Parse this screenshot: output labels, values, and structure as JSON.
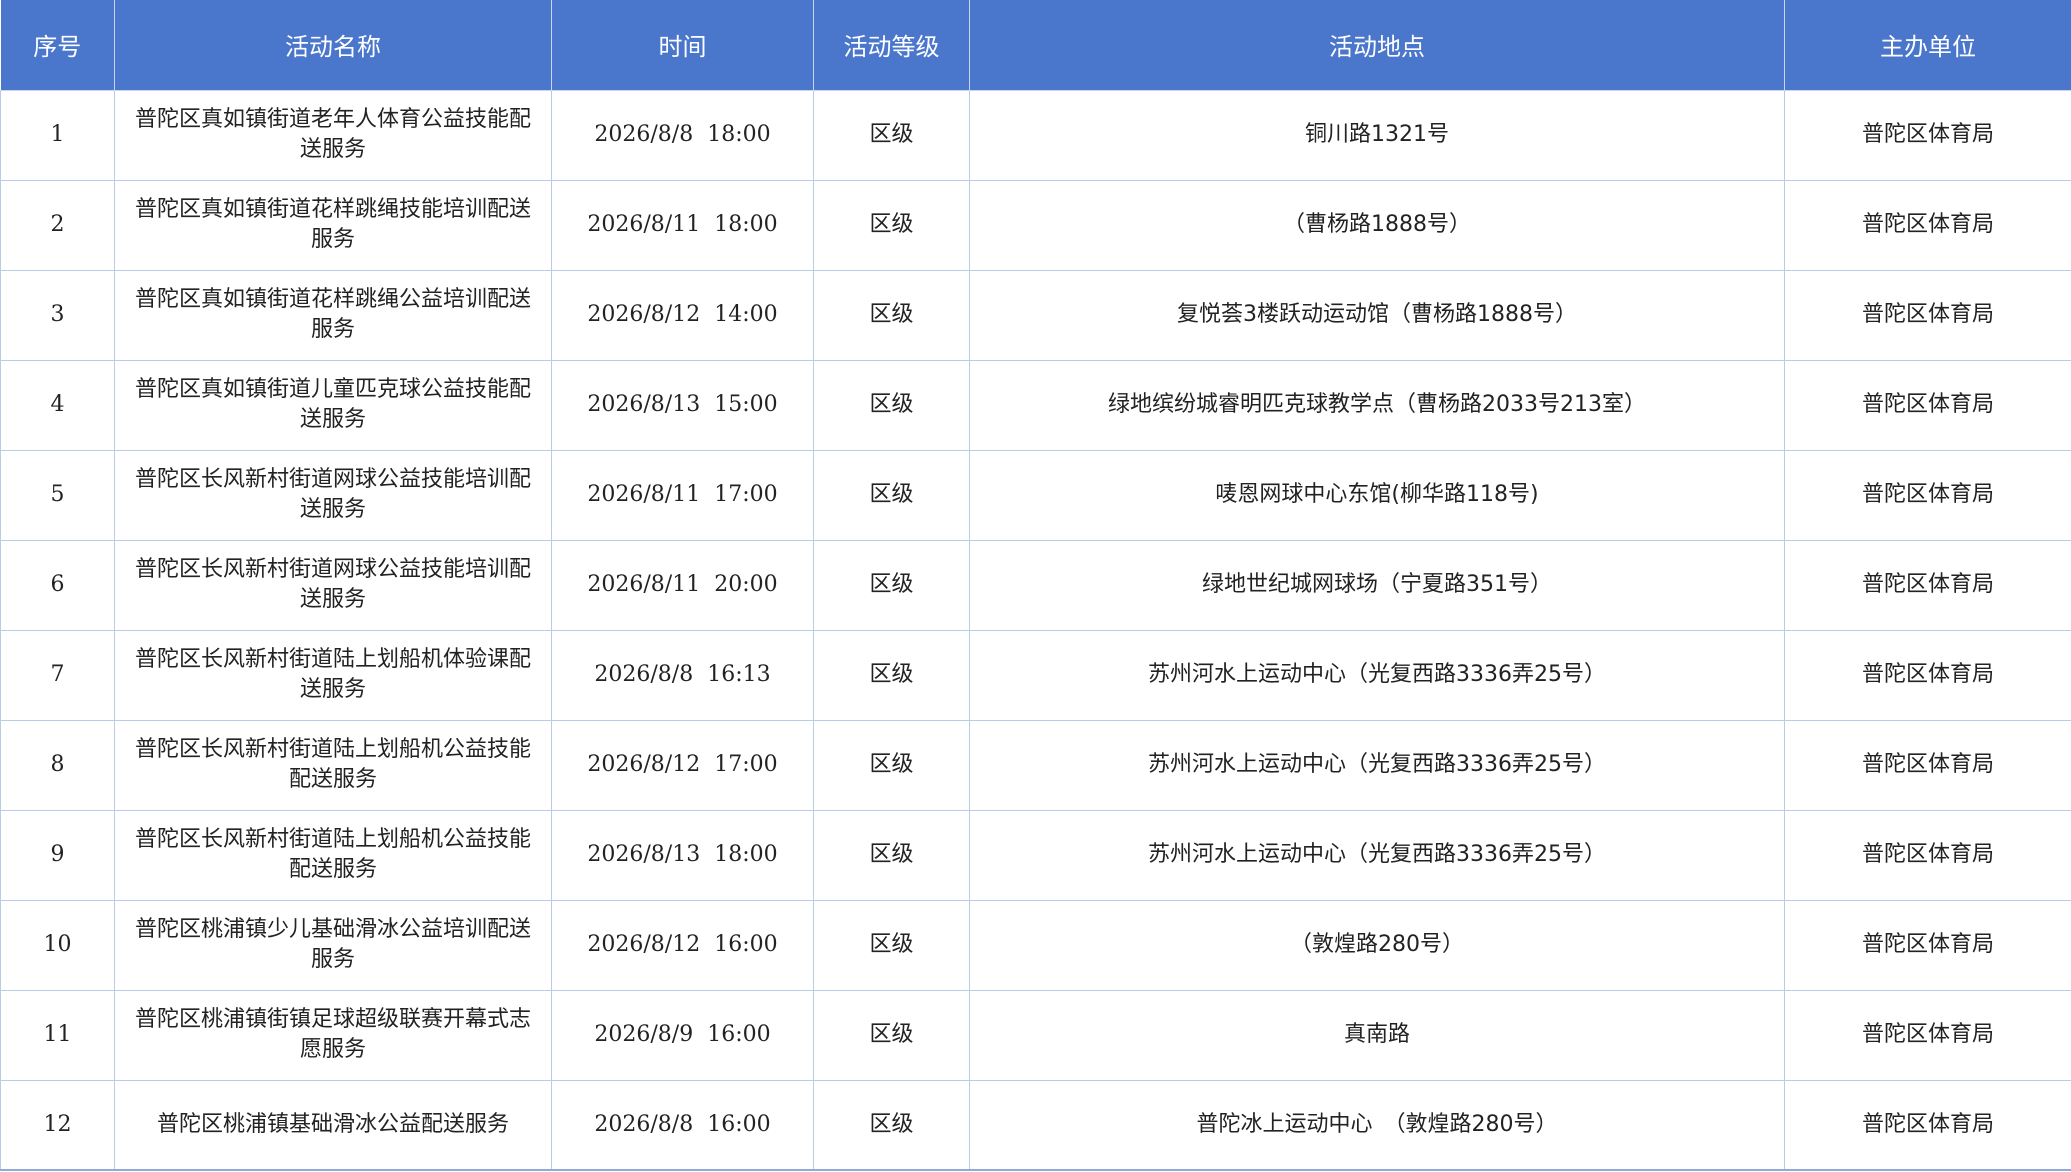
{
  "table": {
    "headers": {
      "index": "序号",
      "name": "活动名称",
      "time": "时间",
      "level": "活动等级",
      "location": "活动地点",
      "organizer": "主办单位"
    },
    "rows": [
      {
        "index": "1",
        "name": "普陀区真如镇街道老年人体育公益技能配送服务",
        "date": "2026/8/8",
        "clock": "18:00",
        "level": "区级",
        "location": "铜川路1321号",
        "organizer": "普陀区体育局"
      },
      {
        "index": "2",
        "name": "普陀区真如镇街道花样跳绳技能培训配送服务",
        "date": "2026/8/11",
        "clock": "18:00",
        "level": "区级",
        "location": "（曹杨路1888号）",
        "organizer": "普陀区体育局"
      },
      {
        "index": "3",
        "name": "普陀区真如镇街道花样跳绳公益培训配送服务",
        "date": "2026/8/12",
        "clock": "14:00",
        "level": "区级",
        "location": "复悦荟3楼跃动运动馆（曹杨路1888号）",
        "organizer": "普陀区体育局"
      },
      {
        "index": "4",
        "name": "普陀区真如镇街道儿童匹克球公益技能配送服务",
        "date": "2026/8/13",
        "clock": "15:00",
        "level": "区级",
        "location": "绿地缤纷城睿明匹克球教学点（曹杨路2033号213室）",
        "organizer": "普陀区体育局"
      },
      {
        "index": "5",
        "name": "普陀区长风新村街道网球公益技能培训配送服务",
        "date": "2026/8/11",
        "clock": "17:00",
        "level": "区级",
        "location": "唛恩网球中心东馆(柳华路118号)",
        "organizer": "普陀区体育局"
      },
      {
        "index": "6",
        "name": "普陀区长风新村街道网球公益技能培训配送服务",
        "date": "2026/8/11",
        "clock": "20:00",
        "level": "区级",
        "location": "绿地世纪城网球场（宁夏路351号）",
        "organizer": "普陀区体育局"
      },
      {
        "index": "7",
        "name": "普陀区长风新村街道陆上划船机体验课配送服务",
        "date": "2026/8/8",
        "clock": "16:13",
        "level": "区级",
        "location": "苏州河水上运动中心（光复西路3336弄25号）",
        "organizer": "普陀区体育局"
      },
      {
        "index": "8",
        "name": "普陀区长风新村街道陆上划船机公益技能配送服务",
        "date": "2026/8/12",
        "clock": "17:00",
        "level": "区级",
        "location": "苏州河水上运动中心（光复西路3336弄25号）",
        "organizer": "普陀区体育局"
      },
      {
        "index": "9",
        "name": "普陀区长风新村街道陆上划船机公益技能配送服务",
        "date": "2026/8/13",
        "clock": "18:00",
        "level": "区级",
        "location": "苏州河水上运动中心（光复西路3336弄25号）",
        "organizer": "普陀区体育局"
      },
      {
        "index": "10",
        "name": "普陀区桃浦镇少儿基础滑冰公益培训配送服务",
        "date": "2026/8/12",
        "clock": "16:00",
        "level": "区级",
        "location": "（敦煌路280号）",
        "organizer": "普陀区体育局"
      },
      {
        "index": "11",
        "name": "普陀区桃浦镇街镇足球超级联赛开幕式志愿服务",
        "date": "2026/8/9",
        "clock": "16:00",
        "level": "区级",
        "location": "真南路",
        "organizer": "普陀区体育局"
      },
      {
        "index": "12",
        "name": "普陀区桃浦镇基础滑冰公益配送服务",
        "date": "2026/8/8",
        "clock": "16:00",
        "level": "区级",
        "location": "普陀冰上运动中心　（敦煌路280号）",
        "organizer": "普陀区体育局"
      }
    ]
  }
}
